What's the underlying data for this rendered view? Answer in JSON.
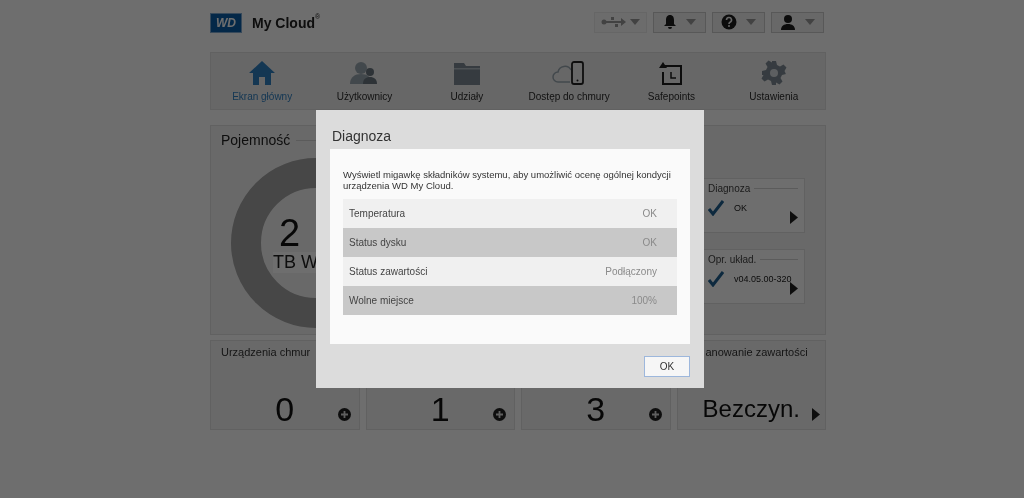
{
  "header": {
    "logo": "WD",
    "brand": "My Cloud",
    "brand_mark": "®",
    "buttons": [
      {
        "kind": "usb",
        "disabled": true
      },
      {
        "kind": "bell",
        "disabled": false
      },
      {
        "kind": "help",
        "disabled": false
      },
      {
        "kind": "user",
        "disabled": false
      }
    ]
  },
  "nav": [
    {
      "label": "Ekran główny",
      "kind": "home",
      "selected": true
    },
    {
      "label": "Użytkownicy",
      "kind": "users",
      "selected": false
    },
    {
      "label": "Udziały",
      "kind": "folder",
      "selected": false
    },
    {
      "label": "Dostęp do chmury",
      "kind": "cloud",
      "selected": false
    },
    {
      "label": "Safepoints",
      "kind": "safepoint",
      "selected": false
    },
    {
      "label": "Ustawienia",
      "kind": "settings",
      "selected": false
    }
  ],
  "capacity": {
    "title": "Pojemność",
    "value": "2",
    "unit": "TB W"
  },
  "status_cards": [
    {
      "title": "Diagnoza",
      "value": "OK"
    },
    {
      "title": "Opr. układ.",
      "value": "v04.05.00-320"
    }
  ],
  "tiles": [
    {
      "title": "Urządzenia chmur",
      "value": "0",
      "kind": "add"
    },
    {
      "value": "1",
      "kind": "add"
    },
    {
      "value": "3",
      "kind": "add"
    },
    {
      "title": "anowanie zawartości",
      "value": "Bezczyn.",
      "kind": "open"
    }
  ],
  "dialog": {
    "title": "Diagnoza",
    "description": "Wyświetl migawkę składników systemu, aby umożliwić ocenę ogólnej kondycji urządzenia WD My Cloud.",
    "rows": [
      {
        "label": "Temperatura",
        "value": "OK"
      },
      {
        "label": "Status dysku",
        "value": "OK"
      },
      {
        "label": "Status zawartości",
        "value": "Podłączony"
      },
      {
        "label": "Wolne miejsce",
        "value": "100%"
      }
    ],
    "button": "OK"
  }
}
